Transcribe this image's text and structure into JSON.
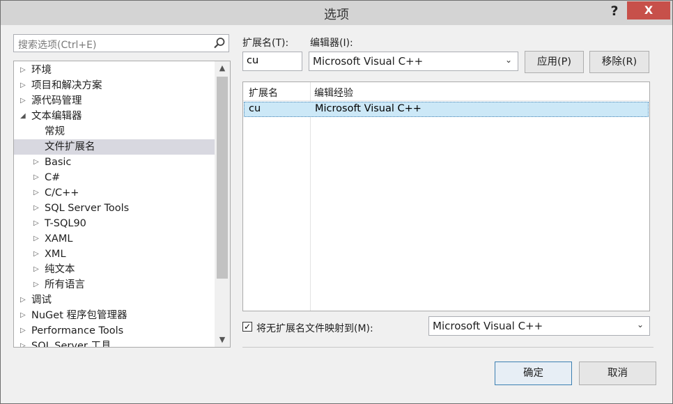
{
  "window": {
    "title": "选项",
    "help": "?",
    "close": "X"
  },
  "search": {
    "placeholder": "搜索选项(Ctrl+E)"
  },
  "tree": {
    "items": [
      {
        "label": "环境",
        "level": 0,
        "expander": "collapsed"
      },
      {
        "label": "项目和解决方案",
        "level": 0,
        "expander": "collapsed"
      },
      {
        "label": "源代码管理",
        "level": 0,
        "expander": "collapsed"
      },
      {
        "label": "文本编辑器",
        "level": 0,
        "expander": "expanded"
      },
      {
        "label": "常规",
        "level": 1,
        "expander": "none"
      },
      {
        "label": "文件扩展名",
        "level": 1,
        "expander": "none",
        "selected": true
      },
      {
        "label": "Basic",
        "level": 1,
        "expander": "collapsed"
      },
      {
        "label": "C#",
        "level": 1,
        "expander": "collapsed"
      },
      {
        "label": "C/C++",
        "level": 1,
        "expander": "collapsed"
      },
      {
        "label": "SQL Server Tools",
        "level": 1,
        "expander": "collapsed"
      },
      {
        "label": "T-SQL90",
        "level": 1,
        "expander": "collapsed"
      },
      {
        "label": "XAML",
        "level": 1,
        "expander": "collapsed"
      },
      {
        "label": "XML",
        "level": 1,
        "expander": "collapsed"
      },
      {
        "label": "纯文本",
        "level": 1,
        "expander": "collapsed"
      },
      {
        "label": "所有语言",
        "level": 1,
        "expander": "collapsed"
      },
      {
        "label": "调试",
        "level": 0,
        "expander": "collapsed"
      },
      {
        "label": "NuGet 程序包管理器",
        "level": 0,
        "expander": "collapsed"
      },
      {
        "label": "Performance Tools",
        "level": 0,
        "expander": "collapsed"
      },
      {
        "label": "SQL Server 工具",
        "level": 0,
        "expander": "collapsed"
      }
    ]
  },
  "form": {
    "extension_label": "扩展名(T):",
    "extension_value": "cu",
    "editor_label": "编辑器(I):",
    "editor_value": "Microsoft Visual C++",
    "apply_label": "应用(P)",
    "remove_label": "移除(R)"
  },
  "grid": {
    "headers": [
      "扩展名",
      "编辑经验"
    ],
    "rows": [
      {
        "ext": "cu",
        "editor": "Microsoft Visual C++"
      }
    ]
  },
  "map": {
    "checkbox_label": "将无扩展名文件映射到(M):",
    "checked": true,
    "editor_value": "Microsoft Visual C++"
  },
  "footer": {
    "ok_label": "确定",
    "cancel_label": "取消"
  }
}
